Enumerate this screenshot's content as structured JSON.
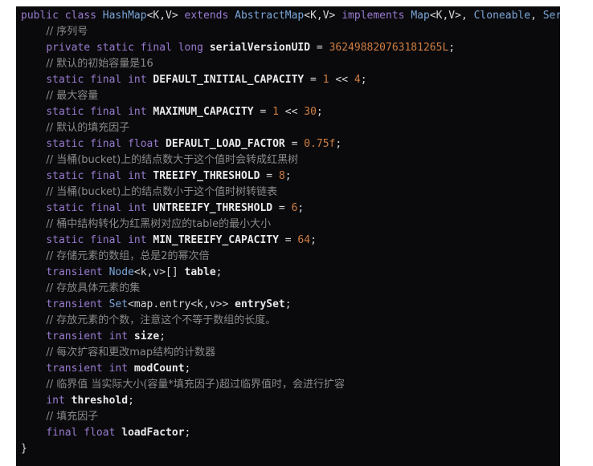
{
  "editor": {
    "language": "java",
    "background_color": "#0a0a0c",
    "page_background_color": "#ffffff",
    "colors": {
      "keyword": "#9a7bd0",
      "type": "#7aa6d8",
      "identifier": "#e8e8ec",
      "number": "#cf7d43",
      "comment": "#8a8a8a",
      "punctuation": "#d6d6da"
    }
  },
  "code": {
    "lines": [
      {
        "n": 1,
        "indent": 0,
        "truncated": true,
        "tokens": [
          {
            "t": "keyword",
            "v": "public"
          },
          {
            "t": "plain",
            "v": " "
          },
          {
            "t": "keyword",
            "v": "class"
          },
          {
            "t": "plain",
            "v": " "
          },
          {
            "t": "type",
            "v": "HashMap"
          },
          {
            "t": "punct",
            "v": "<K,V>"
          },
          {
            "t": "plain",
            "v": " "
          },
          {
            "t": "keyword",
            "v": "extends"
          },
          {
            "t": "plain",
            "v": " "
          },
          {
            "t": "type",
            "v": "AbstractMap"
          },
          {
            "t": "punct",
            "v": "<K,V>"
          },
          {
            "t": "plain",
            "v": " "
          },
          {
            "t": "keyword",
            "v": "implements"
          },
          {
            "t": "plain",
            "v": " "
          },
          {
            "t": "type",
            "v": "Map"
          },
          {
            "t": "punct",
            "v": "<K,V>, "
          },
          {
            "t": "type",
            "v": "Cloneable"
          },
          {
            "t": "punct",
            "v": ", "
          },
          {
            "t": "type",
            "v": "Seri"
          }
        ]
      },
      {
        "n": 2,
        "indent": 1,
        "tokens": [
          {
            "t": "comment",
            "v": "// 序列号"
          }
        ]
      },
      {
        "n": 3,
        "indent": 1,
        "tokens": [
          {
            "t": "keyword",
            "v": "private"
          },
          {
            "t": "plain",
            "v": " "
          },
          {
            "t": "keyword",
            "v": "static"
          },
          {
            "t": "plain",
            "v": " "
          },
          {
            "t": "keyword",
            "v": "final"
          },
          {
            "t": "plain",
            "v": " "
          },
          {
            "t": "keyword",
            "v": "long"
          },
          {
            "t": "plain",
            "v": " "
          },
          {
            "t": "ident",
            "v": "serialVersionUID"
          },
          {
            "t": "punct",
            "v": " = "
          },
          {
            "t": "number",
            "v": "362498820763181265L"
          },
          {
            "t": "punct",
            "v": ";"
          }
        ]
      },
      {
        "n": 4,
        "indent": 1,
        "tokens": [
          {
            "t": "comment",
            "v": "// 默认的初始容量是16"
          }
        ]
      },
      {
        "n": 5,
        "indent": 1,
        "tokens": [
          {
            "t": "keyword",
            "v": "static"
          },
          {
            "t": "plain",
            "v": " "
          },
          {
            "t": "keyword",
            "v": "final"
          },
          {
            "t": "plain",
            "v": " "
          },
          {
            "t": "keyword",
            "v": "int"
          },
          {
            "t": "plain",
            "v": " "
          },
          {
            "t": "ident",
            "v": "DEFAULT_INITIAL_CAPACITY"
          },
          {
            "t": "punct",
            "v": " = "
          },
          {
            "t": "number",
            "v": "1"
          },
          {
            "t": "punct",
            "v": " << "
          },
          {
            "t": "number",
            "v": "4"
          },
          {
            "t": "punct",
            "v": ";"
          }
        ]
      },
      {
        "n": 6,
        "indent": 1,
        "tokens": [
          {
            "t": "comment",
            "v": "// 最大容量"
          }
        ]
      },
      {
        "n": 7,
        "indent": 1,
        "tokens": [
          {
            "t": "keyword",
            "v": "static"
          },
          {
            "t": "plain",
            "v": " "
          },
          {
            "t": "keyword",
            "v": "final"
          },
          {
            "t": "plain",
            "v": " "
          },
          {
            "t": "keyword",
            "v": "int"
          },
          {
            "t": "plain",
            "v": " "
          },
          {
            "t": "ident",
            "v": "MAXIMUM_CAPACITY"
          },
          {
            "t": "punct",
            "v": " = "
          },
          {
            "t": "number",
            "v": "1"
          },
          {
            "t": "punct",
            "v": " << "
          },
          {
            "t": "number",
            "v": "30"
          },
          {
            "t": "punct",
            "v": ";"
          }
        ]
      },
      {
        "n": 8,
        "indent": 1,
        "tokens": [
          {
            "t": "comment",
            "v": "// 默认的填充因子"
          }
        ]
      },
      {
        "n": 9,
        "indent": 1,
        "tokens": [
          {
            "t": "keyword",
            "v": "static"
          },
          {
            "t": "plain",
            "v": " "
          },
          {
            "t": "keyword",
            "v": "final"
          },
          {
            "t": "plain",
            "v": " "
          },
          {
            "t": "keyword",
            "v": "float"
          },
          {
            "t": "plain",
            "v": " "
          },
          {
            "t": "ident",
            "v": "DEFAULT_LOAD_FACTOR"
          },
          {
            "t": "punct",
            "v": " = "
          },
          {
            "t": "number",
            "v": "0.75f"
          },
          {
            "t": "punct",
            "v": ";"
          }
        ]
      },
      {
        "n": 10,
        "indent": 1,
        "tokens": [
          {
            "t": "comment",
            "v": "// 当桶(bucket)上的结点数大于这个值时会转成红黑树"
          }
        ]
      },
      {
        "n": 11,
        "indent": 1,
        "tokens": [
          {
            "t": "keyword",
            "v": "static"
          },
          {
            "t": "plain",
            "v": " "
          },
          {
            "t": "keyword",
            "v": "final"
          },
          {
            "t": "plain",
            "v": " "
          },
          {
            "t": "keyword",
            "v": "int"
          },
          {
            "t": "plain",
            "v": " "
          },
          {
            "t": "ident",
            "v": "TREEIFY_THRESHOLD"
          },
          {
            "t": "punct",
            "v": " = "
          },
          {
            "t": "number",
            "v": "8"
          },
          {
            "t": "punct",
            "v": ";"
          }
        ]
      },
      {
        "n": 12,
        "indent": 1,
        "tokens": [
          {
            "t": "comment",
            "v": "// 当桶(bucket)上的结点数小于这个值时树转链表"
          }
        ]
      },
      {
        "n": 13,
        "indent": 1,
        "tokens": [
          {
            "t": "keyword",
            "v": "static"
          },
          {
            "t": "plain",
            "v": " "
          },
          {
            "t": "keyword",
            "v": "final"
          },
          {
            "t": "plain",
            "v": " "
          },
          {
            "t": "keyword",
            "v": "int"
          },
          {
            "t": "plain",
            "v": " "
          },
          {
            "t": "ident",
            "v": "UNTREEIFY_THRESHOLD"
          },
          {
            "t": "punct",
            "v": " = "
          },
          {
            "t": "number",
            "v": "6"
          },
          {
            "t": "punct",
            "v": ";"
          }
        ]
      },
      {
        "n": 14,
        "indent": 1,
        "tokens": [
          {
            "t": "comment",
            "v": "// 桶中结构转化为红黑树对应的table的最小大小"
          }
        ]
      },
      {
        "n": 15,
        "indent": 1,
        "tokens": [
          {
            "t": "keyword",
            "v": "static"
          },
          {
            "t": "plain",
            "v": " "
          },
          {
            "t": "keyword",
            "v": "final"
          },
          {
            "t": "plain",
            "v": " "
          },
          {
            "t": "keyword",
            "v": "int"
          },
          {
            "t": "plain",
            "v": " "
          },
          {
            "t": "ident",
            "v": "MIN_TREEIFY_CAPACITY"
          },
          {
            "t": "punct",
            "v": " = "
          },
          {
            "t": "number",
            "v": "64"
          },
          {
            "t": "punct",
            "v": ";"
          }
        ]
      },
      {
        "n": 16,
        "indent": 1,
        "tokens": [
          {
            "t": "comment",
            "v": "// 存储元素的数组，总是2的幂次倍"
          }
        ]
      },
      {
        "n": 17,
        "indent": 1,
        "tokens": [
          {
            "t": "keyword",
            "v": "transient"
          },
          {
            "t": "plain",
            "v": " "
          },
          {
            "t": "type",
            "v": "Node"
          },
          {
            "t": "punct",
            "v": "<k,v>[] "
          },
          {
            "t": "ident",
            "v": "table"
          },
          {
            "t": "punct",
            "v": ";"
          }
        ]
      },
      {
        "n": 18,
        "indent": 1,
        "tokens": [
          {
            "t": "comment",
            "v": "// 存放具体元素的集"
          }
        ]
      },
      {
        "n": 19,
        "indent": 1,
        "tokens": [
          {
            "t": "keyword",
            "v": "transient"
          },
          {
            "t": "plain",
            "v": " "
          },
          {
            "t": "type",
            "v": "Set"
          },
          {
            "t": "punct",
            "v": "<map.entry<k,v>> "
          },
          {
            "t": "ident",
            "v": "entrySet"
          },
          {
            "t": "punct",
            "v": ";"
          }
        ]
      },
      {
        "n": 20,
        "indent": 1,
        "tokens": [
          {
            "t": "comment",
            "v": "// 存放元素的个数，注意这个不等于数组的长度。"
          }
        ]
      },
      {
        "n": 21,
        "indent": 1,
        "tokens": [
          {
            "t": "keyword",
            "v": "transient"
          },
          {
            "t": "plain",
            "v": " "
          },
          {
            "t": "keyword",
            "v": "int"
          },
          {
            "t": "plain",
            "v": " "
          },
          {
            "t": "ident",
            "v": "size"
          },
          {
            "t": "punct",
            "v": ";"
          }
        ]
      },
      {
        "n": 22,
        "indent": 1,
        "tokens": [
          {
            "t": "comment",
            "v": "// 每次扩容和更改map结构的计数器"
          }
        ]
      },
      {
        "n": 23,
        "indent": 1,
        "tokens": [
          {
            "t": "keyword",
            "v": "transient"
          },
          {
            "t": "plain",
            "v": " "
          },
          {
            "t": "keyword",
            "v": "int"
          },
          {
            "t": "plain",
            "v": " "
          },
          {
            "t": "ident",
            "v": "modCount"
          },
          {
            "t": "punct",
            "v": ";"
          }
        ]
      },
      {
        "n": 24,
        "indent": 1,
        "tokens": [
          {
            "t": "comment",
            "v": "// 临界值 当实际大小(容量*填充因子)超过临界值时，会进行扩容"
          }
        ]
      },
      {
        "n": 25,
        "indent": 1,
        "tokens": [
          {
            "t": "keyword",
            "v": "int"
          },
          {
            "t": "plain",
            "v": " "
          },
          {
            "t": "ident",
            "v": "threshold"
          },
          {
            "t": "punct",
            "v": ";"
          }
        ]
      },
      {
        "n": 26,
        "indent": 1,
        "tokens": [
          {
            "t": "comment",
            "v": "// 填充因子"
          }
        ]
      },
      {
        "n": 27,
        "indent": 1,
        "tokens": [
          {
            "t": "keyword",
            "v": "final"
          },
          {
            "t": "plain",
            "v": " "
          },
          {
            "t": "keyword",
            "v": "float"
          },
          {
            "t": "plain",
            "v": " "
          },
          {
            "t": "ident",
            "v": "loadFactor"
          },
          {
            "t": "punct",
            "v": ";"
          }
        ]
      },
      {
        "n": 28,
        "indent": 0,
        "tokens": [
          {
            "t": "punct",
            "v": "}"
          }
        ]
      }
    ]
  }
}
